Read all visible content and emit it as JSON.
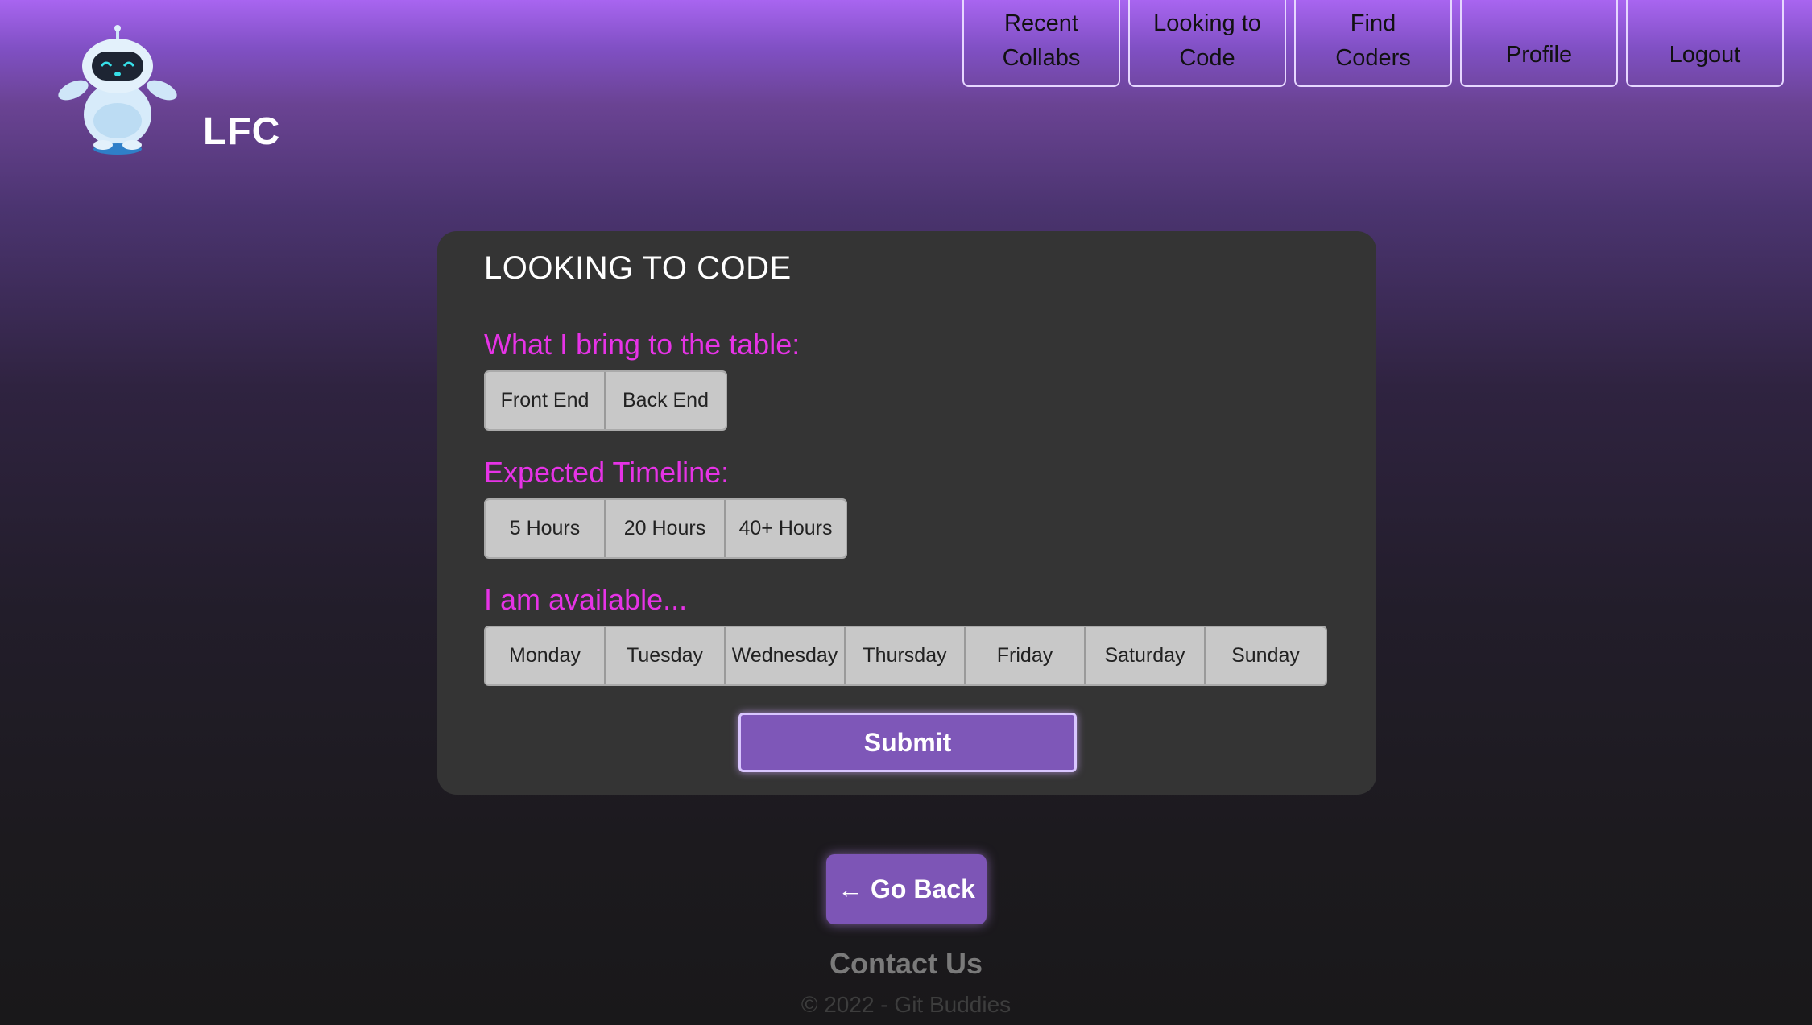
{
  "brand": {
    "name": "LFC",
    "logo_icon": "robot-mascot-icon"
  },
  "nav": {
    "items": [
      {
        "label_line1": "Recent",
        "label_line2": "Collabs"
      },
      {
        "label_line1": "Looking to",
        "label_line2": "Code"
      },
      {
        "label_line1": "Find",
        "label_line2": "Coders"
      },
      {
        "label_line1": "",
        "label_line2": "Profile"
      },
      {
        "label_line1": "",
        "label_line2": "Logout"
      }
    ]
  },
  "form": {
    "title": "LOOKING TO CODE",
    "skills": {
      "label": "What I bring to the table:",
      "options": [
        "Front End",
        "Back End"
      ]
    },
    "timeline": {
      "label": "Expected Timeline:",
      "options": [
        "5 Hours",
        "20 Hours",
        "40+ Hours"
      ]
    },
    "availability": {
      "label": "I am available...",
      "options": [
        "Monday",
        "Tuesday",
        "Wednesday",
        "Thursday",
        "Friday",
        "Saturday",
        "Sunday"
      ]
    },
    "submit_label": "Submit"
  },
  "footer": {
    "go_back_label": "← Go Back",
    "contact_label": "Contact Us",
    "copyright": "© 2022 - Git Buddies"
  },
  "colors": {
    "accent_magenta": "#e633e6",
    "button_purple": "#7e57b8",
    "card_bg": "#343434",
    "header_purple": "#a865f0"
  }
}
